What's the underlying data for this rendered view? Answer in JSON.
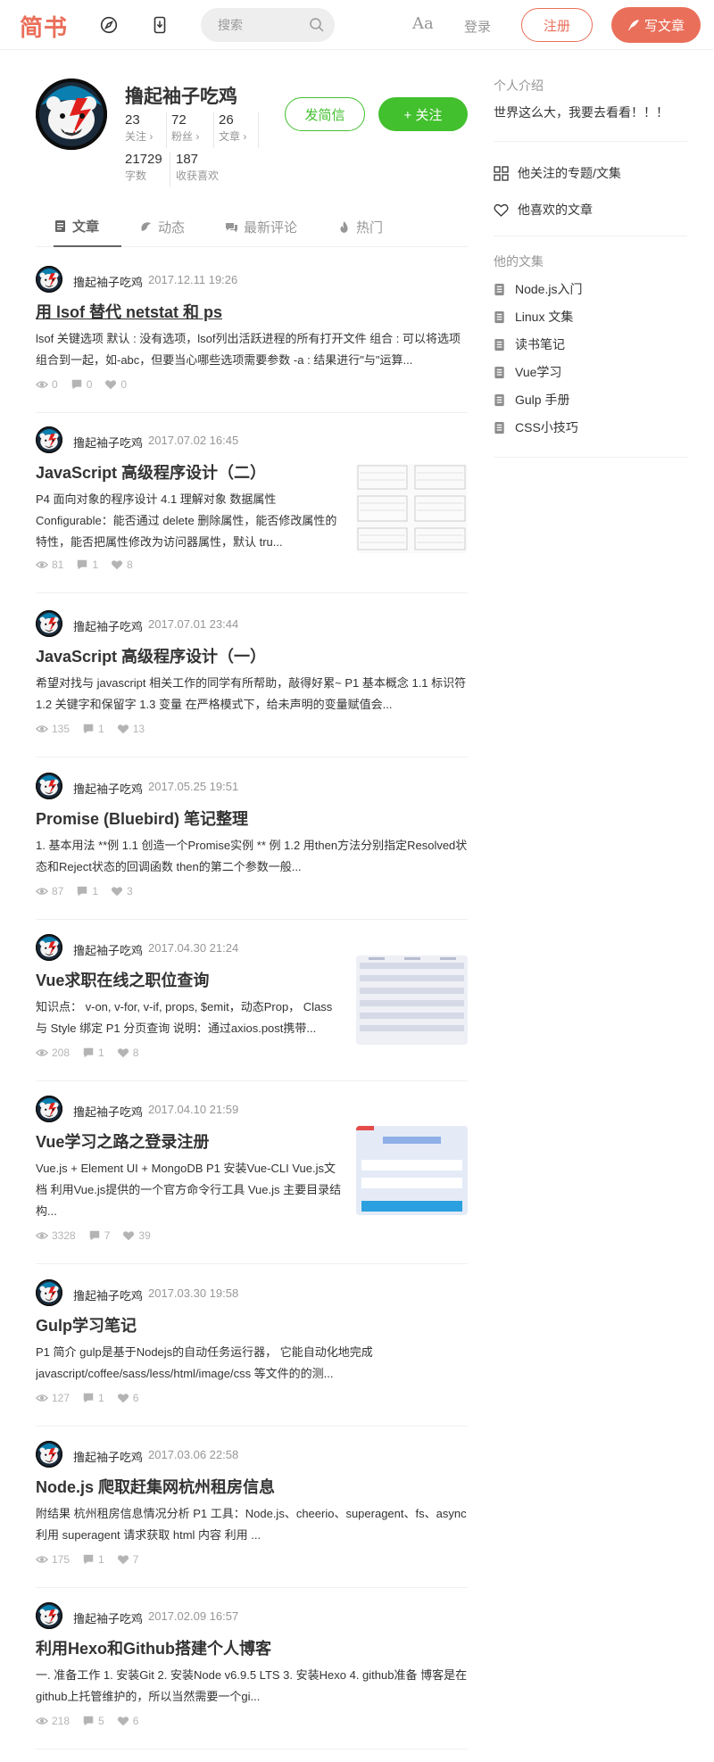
{
  "nav": {
    "logo": "简书",
    "search_placeholder": "搜索",
    "font_toggle": "Aa",
    "login": "登录",
    "register": "注册",
    "write": "写文章"
  },
  "profile": {
    "name": "撸起袖子吃鸡",
    "stats": [
      {
        "num": "23",
        "label": "关注 ›"
      },
      {
        "num": "72",
        "label": "粉丝 ›"
      },
      {
        "num": "26",
        "label": "文章 ›"
      },
      {
        "num": "21729",
        "label": "字数"
      },
      {
        "num": "187",
        "label": "收获喜欢"
      }
    ],
    "message_btn": "发简信",
    "follow_btn": "+ 关注"
  },
  "tabs": [
    {
      "label": "文章",
      "icon": "article-icon"
    },
    {
      "label": "动态",
      "icon": "activity-icon"
    },
    {
      "label": "最新评论",
      "icon": "comment-icon"
    },
    {
      "label": "热门",
      "icon": "fire-icon"
    }
  ],
  "articles": [
    {
      "author": "撸起袖子吃鸡",
      "time": "2017.12.11 19:26",
      "title": "用 lsof 替代 netstat 和 ps",
      "abstract": "lsof 关键选项 默认 : 没有选项，lsof列出活跃进程的所有打开文件 组合 : 可以将选项组合到一起，如-abc，但要当心哪些选项需要参数 -a : 结果进行\"与\"运算...",
      "views": "0",
      "comments": "0",
      "likes": "0"
    },
    {
      "author": "撸起袖子吃鸡",
      "time": "2017.07.02 16:45",
      "title": "JavaScript 高级程序设计（二）",
      "abstract": "P4 面向对象的程序设计 4.1 理解对象 数据属性 Configurable：能否通过 delete 删除属性，能否修改属性的特性，能否把属性修改为访问器属性，默认 tru...",
      "views": "81",
      "comments": "1",
      "likes": "8"
    },
    {
      "author": "撸起袖子吃鸡",
      "time": "2017.07.01 23:44",
      "title": "JavaScript 高级程序设计（一）",
      "abstract": "希望对找与 javascript 相关工作的同学有所帮助，敲得好累~ P1 基本概念 1.1 标识符 1.2 关键字和保留字 1.3 变量 在严格模式下，给未声明的变量赋值会...",
      "views": "135",
      "comments": "1",
      "likes": "13"
    },
    {
      "author": "撸起袖子吃鸡",
      "time": "2017.05.25 19:51",
      "title": "Promise (Bluebird) 笔记整理",
      "abstract": "1. 基本用法 **例 1.1 创造一个Promise实例 ** 例 1.2 用then方法分别指定Resolved状态和Reject状态的回调函数 then的第二个参数一般...",
      "views": "87",
      "comments": "1",
      "likes": "3"
    },
    {
      "author": "撸起袖子吃鸡",
      "time": "2017.04.30 21:24",
      "title": "Vue求职在线之职位查询",
      "abstract": "知识点： v-on, v-for, v-if, props, $emit，动态Prop， Class 与 Style 绑定 P1 分页查询 说明：通过axios.post携带...",
      "views": "208",
      "comments": "1",
      "likes": "8"
    },
    {
      "author": "撸起袖子吃鸡",
      "time": "2017.04.10 21:59",
      "title": "Vue学习之路之登录注册",
      "abstract": "Vue.js + Element UI + MongoDB P1 安装Vue-CLI Vue.js文档 利用Vue.js提供的一个官方命令行工具 Vue.js 主要目录结构...",
      "views": "3328",
      "comments": "7",
      "likes": "39"
    },
    {
      "author": "撸起袖子吃鸡",
      "time": "2017.03.30 19:58",
      "title": "Gulp学习笔记",
      "abstract": "P1 简介 gulp是基于Nodejs的自动任务运行器， 它能自动化地完成 javascript/coffee/sass/less/html/image/css 等文件的的测...",
      "views": "127",
      "comments": "1",
      "likes": "6"
    },
    {
      "author": "撸起袖子吃鸡",
      "time": "2017.03.06 22:58",
      "title": "Node.js 爬取赶集网杭州租房信息",
      "abstract": "附结果 杭州租房信息情况分析 P1 工具：Node.js、cheerio、superagent、fs、async 利用 superagent 请求获取 html 内容 利用 ...",
      "views": "175",
      "comments": "1",
      "likes": "7"
    },
    {
      "author": "撸起袖子吃鸡",
      "time": "2017.02.09 16:57",
      "title": "利用Hexo和Github搭建个人博客",
      "abstract": "一. 准备工作 1. 安装Git 2. 安装Node v6.9.5 LTS 3. 安装Hexo 4. github准备 博客是在github上托管维护的，所以当然需要一个gi...",
      "views": "218",
      "comments": "5",
      "likes": "6"
    }
  ],
  "sidebar": {
    "intro_title": "个人介绍",
    "intro_text": "世界这么大，我要去看看！！！",
    "links": [
      {
        "label": "他关注的专题/文集",
        "icon": "grid-icon"
      },
      {
        "label": "他喜欢的文章",
        "icon": "heart-icon"
      }
    ],
    "collections_title": "他的文集",
    "collections": [
      "Node.js入门",
      "Linux 文集",
      "读书笔记",
      "Vue学习",
      "Gulp 手册",
      "CSS小技巧"
    ]
  },
  "colors": {
    "brand": "#ea6f5a",
    "green": "#42c02e",
    "meta": "#b4b4b4"
  }
}
